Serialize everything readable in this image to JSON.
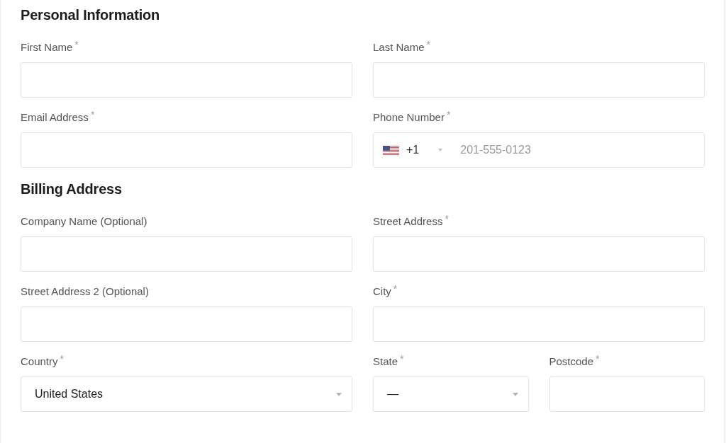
{
  "sections": [
    {
      "title": "Personal Information",
      "rows": [
        [
          {
            "kind": "text",
            "label": "First Name",
            "required_mark": "*"
          },
          {
            "kind": "text",
            "label": "Last Name",
            "required_mark": "*"
          }
        ],
        [
          {
            "kind": "text",
            "label": "Email Address",
            "required_mark": "*"
          },
          {
            "kind": "phone",
            "label": "Phone Number",
            "required_mark": "*",
            "dial_code": "+1",
            "placeholder": "201-555-0123"
          }
        ]
      ]
    },
    {
      "title": "Billing Address",
      "rows": [
        [
          {
            "kind": "text",
            "label": "Company Name (Optional)"
          },
          {
            "kind": "text",
            "label": "Street Address",
            "required_mark": "*"
          }
        ],
        [
          {
            "kind": "text",
            "label": "Street Address 2 (Optional)"
          },
          {
            "kind": "text",
            "label": "City",
            "required_mark": "*"
          }
        ],
        [
          {
            "kind": "select",
            "label": "Country",
            "required_mark": "*",
            "value": "United States"
          },
          {
            "kind": "select",
            "label": "State",
            "required_mark": "*",
            "value": "—"
          },
          {
            "kind": "text",
            "label": "Postcode",
            "required_mark": "*"
          }
        ]
      ]
    }
  ]
}
